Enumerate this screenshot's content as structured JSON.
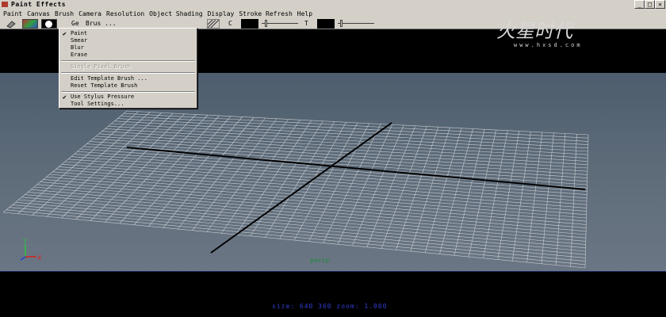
{
  "window": {
    "title": "Paint Effects",
    "btn_minimize": "_",
    "btn_maximize": "□",
    "btn_close": "✕"
  },
  "menubar": {
    "items": [
      "Paint",
      "Canvas",
      "Brush",
      "Camera",
      "Resolution",
      "Object Shading",
      "Display",
      "Stroke Refresh",
      "Help"
    ]
  },
  "toolbar": {
    "tool_label": "Ge",
    "brush_field": "Brus ...",
    "c_label": "C",
    "t_label": "T"
  },
  "dropdown": {
    "items": [
      {
        "label": "Paint",
        "checked": "✔"
      },
      {
        "label": "Smear",
        "checked": ""
      },
      {
        "label": "Blur",
        "checked": ""
      },
      {
        "label": "Erase",
        "checked": ""
      },
      {
        "label": "Single Pixel Brush",
        "checked": "",
        "disabled": true
      },
      {
        "label": "Edit Template Brush ...",
        "checked": ""
      },
      {
        "label": "Reset Template Brush",
        "checked": ""
      },
      {
        "label": "Use Stylus Pressure",
        "checked": "✔"
      },
      {
        "label": "Tool Settings...",
        "checked": ""
      }
    ]
  },
  "watermark": {
    "logo": "火星时代",
    "url": "www.hxsd.com"
  },
  "axis": {
    "y": "Y",
    "x": "X"
  },
  "viewport": {
    "green_label": "persp",
    "status": "size: 640  360 zoom: 1.000"
  },
  "colors": {
    "menu_bg": "#d4d0c8",
    "viewport_top": "#4d5d6d",
    "status_blue": "#2f3fcf",
    "grid": "#c8ccd0"
  }
}
